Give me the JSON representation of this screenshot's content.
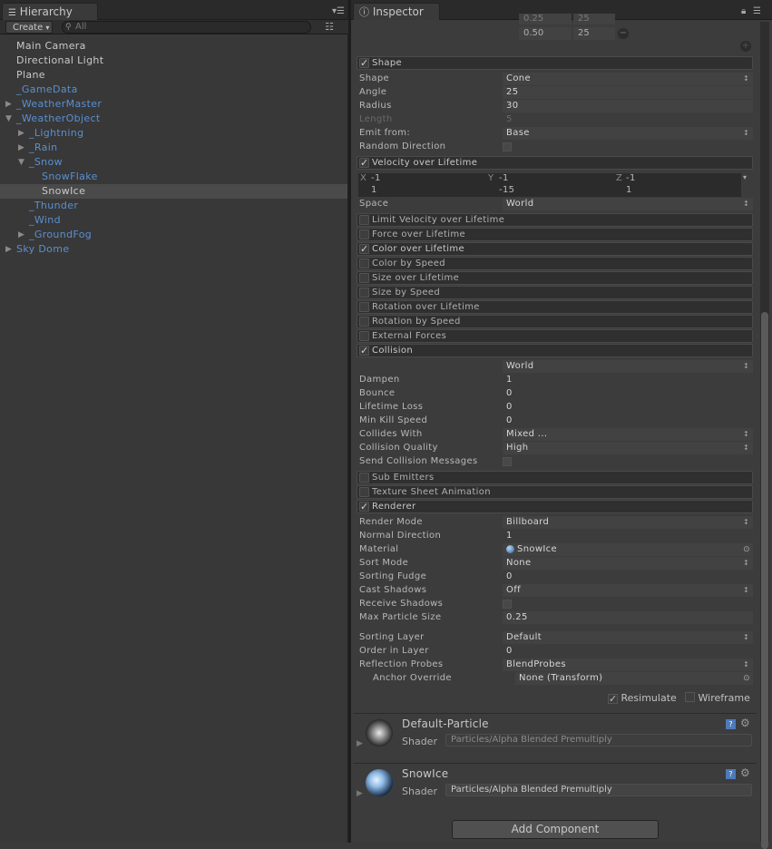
{
  "hierarchy": {
    "tab_title": "Hierarchy",
    "create_label": "Create",
    "search_placeholder": "All",
    "items": [
      {
        "label": "Main Camera",
        "color": "white",
        "indent": 0,
        "expander": ""
      },
      {
        "label": "Directional Light",
        "color": "white",
        "indent": 0,
        "expander": ""
      },
      {
        "label": "Plane",
        "color": "white",
        "indent": 0,
        "expander": ""
      },
      {
        "label": "_GameData",
        "color": "blue",
        "indent": 0,
        "expander": ""
      },
      {
        "label": "_WeatherMaster",
        "color": "blue",
        "indent": 0,
        "expander": "collapsed"
      },
      {
        "label": "_WeatherObject",
        "color": "blue",
        "indent": 0,
        "expander": "expanded"
      },
      {
        "label": "_Lightning",
        "color": "blue",
        "indent": 1,
        "expander": "collapsed"
      },
      {
        "label": "_Rain",
        "color": "blue",
        "indent": 1,
        "expander": "collapsed"
      },
      {
        "label": "_Snow",
        "color": "blue",
        "indent": 1,
        "expander": "expanded"
      },
      {
        "label": "SnowFlake",
        "color": "blue",
        "indent": 2,
        "expander": ""
      },
      {
        "label": "SnowIce",
        "color": "white",
        "indent": 2,
        "expander": "",
        "selected": true
      },
      {
        "label": "_Thunder",
        "color": "blue",
        "indent": 1,
        "expander": ""
      },
      {
        "label": "_Wind",
        "color": "blue",
        "indent": 1,
        "expander": ""
      },
      {
        "label": "_GroundFog",
        "color": "blue",
        "indent": 1,
        "expander": "collapsed"
      },
      {
        "label": "Sky Dome",
        "color": "blue",
        "indent": 0,
        "expander": "collapsed"
      }
    ]
  },
  "inspector": {
    "tab_title": "Inspector",
    "curve_keys": [
      {
        "a": "0.25",
        "b": "25"
      },
      {
        "a": "0.50",
        "b": "25"
      }
    ],
    "shape_module": {
      "title": "Shape",
      "shape": {
        "label": "Shape",
        "value": "Cone"
      },
      "angle": {
        "label": "Angle",
        "value": "25"
      },
      "radius": {
        "label": "Radius",
        "value": "30"
      },
      "length": {
        "label": "Length",
        "value": "5"
      },
      "emit_from": {
        "label": "Emit from:",
        "value": "Base"
      },
      "random_direction": {
        "label": "Random Direction"
      }
    },
    "velocity_module": {
      "title": "Velocity over Lifetime",
      "x_label": "X",
      "x_min": "-1",
      "x_max": "1",
      "y_label": "Y",
      "y_min": "-1",
      "y_max": "-15",
      "z_label": "Z",
      "z_min": "-1",
      "z_max": "1",
      "space": {
        "label": "Space",
        "value": "World"
      }
    },
    "modules": [
      {
        "label": "Limit Velocity over Lifetime",
        "checked": false
      },
      {
        "label": "Force over Lifetime",
        "checked": false
      },
      {
        "label": "Color over Lifetime",
        "checked": true
      },
      {
        "label": "Color by Speed",
        "checked": false
      },
      {
        "label": "Size over Lifetime",
        "checked": false
      },
      {
        "label": "Size by Speed",
        "checked": false
      },
      {
        "label": "Rotation over Lifetime",
        "checked": false
      },
      {
        "label": "Rotation by Speed",
        "checked": false
      },
      {
        "label": "External Forces",
        "checked": false
      }
    ],
    "collision_module": {
      "title": "Collision",
      "type_value": "World",
      "fields": [
        {
          "label": "Dampen",
          "value": "1"
        },
        {
          "label": "Bounce",
          "value": "0"
        },
        {
          "label": "Lifetime Loss",
          "value": "0"
        },
        {
          "label": "Min Kill Speed",
          "value": "0"
        },
        {
          "label": "Collides With",
          "value": "Mixed ..."
        },
        {
          "label": "Collision Quality",
          "value": "High"
        }
      ],
      "send_messages_label": "Send Collision Messages"
    },
    "modules2": [
      {
        "label": "Sub Emitters",
        "checked": false
      },
      {
        "label": "Texture Sheet Animation",
        "checked": false
      }
    ],
    "renderer_module": {
      "title": "Renderer",
      "render_mode": {
        "label": "Render Mode",
        "value": "Billboard"
      },
      "normal_direction": {
        "label": "Normal Direction",
        "value": "1"
      },
      "material": {
        "label": "Material",
        "value": "SnowIce"
      },
      "sort_mode": {
        "label": "Sort Mode",
        "value": "None"
      },
      "sorting_fudge": {
        "label": "Sorting Fudge",
        "value": "0"
      },
      "cast_shadows": {
        "label": "Cast Shadows",
        "value": "Off"
      },
      "receive_shadows": {
        "label": "Receive Shadows"
      },
      "max_particle_size": {
        "label": "Max Particle Size",
        "value": "0.25"
      },
      "sorting_layer": {
        "label": "Sorting Layer",
        "value": "Default"
      },
      "order_in_layer": {
        "label": "Order in Layer",
        "value": "0"
      },
      "reflection_probes": {
        "label": "Reflection Probes",
        "value": "BlendProbes"
      },
      "anchor_override": {
        "label": "Anchor Override",
        "value": "None (Transform)"
      }
    },
    "resimulate_label": "Resimulate",
    "wireframe_label": "Wireframe",
    "materials": [
      {
        "name": "Default-Particle",
        "shader_label": "Shader",
        "shader": "Particles/Alpha Blended Premultiply"
      },
      {
        "name": "SnowIce",
        "shader_label": "Shader",
        "shader": "Particles/Alpha Blended Premultiply"
      }
    ],
    "add_component_label": "Add Component"
  }
}
